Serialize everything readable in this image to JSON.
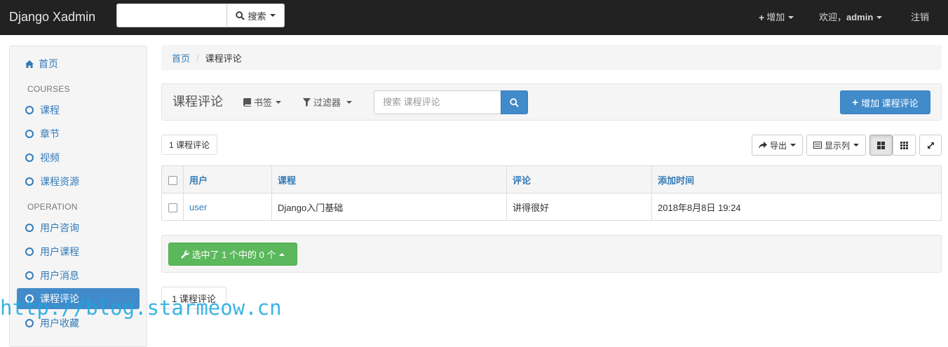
{
  "navbar": {
    "brand": "Django Xadmin",
    "search_button": "搜索",
    "add": "增加",
    "welcome": "欢迎，",
    "user": "admin",
    "logout": "注销"
  },
  "sidebar": {
    "home": "首页",
    "groups": [
      {
        "title": "COURSES",
        "items": [
          "课程",
          "章节",
          "视频",
          "课程资源"
        ]
      },
      {
        "title": "OPERATION",
        "items": [
          "用户咨询",
          "用户课程",
          "用户消息",
          "课程评论",
          "用户收藏"
        ]
      }
    ],
    "active": "课程评论"
  },
  "breadcrumb": {
    "home": "首页",
    "separator": "/",
    "current": "课程评论"
  },
  "header": {
    "title": "课程评论",
    "bookmarks": "书签",
    "filters": "过滤器",
    "search_placeholder": "搜索 课程评论",
    "add_button": "增加 课程评论"
  },
  "toolbar": {
    "count": "1 课程评论",
    "export": "导出",
    "columns": "显示列"
  },
  "table": {
    "headers": [
      "用户",
      "课程",
      "评论",
      "添加时间"
    ],
    "rows": [
      {
        "user": "user",
        "course": "Django入门基础",
        "comment": "讲得很好",
        "time": "2018年8月8日 19:24"
      }
    ]
  },
  "actions": {
    "label": "选中了 1 个中的 0 个"
  },
  "footer": {
    "count": "1 课程评论"
  },
  "watermark": "http://blog.starmeow.cn",
  "colors": {
    "navbar": "#222222",
    "primary": "#428bca",
    "success": "#5cb85c",
    "link": "#337ab7"
  }
}
